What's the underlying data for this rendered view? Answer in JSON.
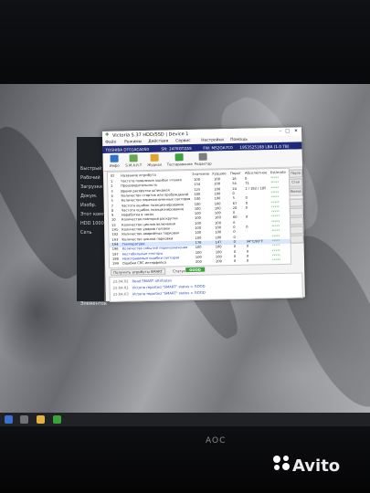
{
  "window": {
    "title": "Victoria 5.37 HDD/SSD | Device 1",
    "menu": [
      "Файл",
      "Режимы",
      "Действия",
      "Сервис",
      "Настройки",
      "Помощь"
    ],
    "info": [
      "TOSHIBA DT01ACA050",
      "SN: 247KGTZAS",
      "FW: MS2OA7C0",
      "1953525168 LBA (1.0 TB)"
    ],
    "toolbar": [
      "Инфо",
      "S.M.A.R.T",
      "Журнал",
      "Тестирование",
      "Редактор"
    ],
    "table_headers": [
      "ID",
      "Название атрибута",
      "Значение",
      "Худшее",
      "Порог",
      "Абсолютное",
      "Estimate"
    ],
    "rows": [
      {
        "id": "1",
        "name": "Частота появления ошибок чтения",
        "val": "100",
        "worst": "100",
        "thr": "16",
        "raw": "0",
        "est": "*****"
      },
      {
        "id": "2",
        "name": "Производительность",
        "val": "134",
        "worst": "100",
        "thr": "54",
        "raw": "71",
        "est": "*****"
      },
      {
        "id": "3",
        "name": "Время раскрутки шпинделя",
        "val": "125",
        "worst": "100",
        "thr": "24",
        "raw": "2 / 182 / 185",
        "est": "*****"
      },
      {
        "id": "4",
        "name": "Количество стартов или пробуждений",
        "val": "100",
        "worst": "100",
        "thr": "0",
        "raw": "",
        "est": "*****"
      },
      {
        "id": "5",
        "name": "Количество переназначенных секторов",
        "val": "100",
        "worst": "100",
        "thr": "5",
        "raw": "0",
        "est": "*****"
      },
      {
        "id": "7",
        "name": "Частота ошибок позиционирования",
        "val": "100",
        "worst": "100",
        "thr": "67",
        "raw": "0",
        "est": "*****"
      },
      {
        "id": "8",
        "name": "Частота ошибок позиционирования",
        "val": "100",
        "worst": "100",
        "thr": "20",
        "raw": "0",
        "est": "*****"
      },
      {
        "id": "9",
        "name": "Наработка в часах",
        "val": "100",
        "worst": "100",
        "thr": "0",
        "raw": "",
        "est": "*****"
      },
      {
        "id": "10",
        "name": "Количество повторов раскрутки",
        "val": "100",
        "worst": "100",
        "thr": "60",
        "raw": "0",
        "est": "*****"
      },
      {
        "id": "12",
        "name": "Количество циклов включения",
        "val": "100",
        "worst": "100",
        "thr": "0",
        "raw": "",
        "est": "*****"
      },
      {
        "id": "191",
        "name": "Количество ударов головок",
        "val": "100",
        "worst": "100",
        "thr": "0",
        "raw": "0",
        "est": "*****"
      },
      {
        "id": "192",
        "name": "Количество аварийных парковок",
        "val": "100",
        "worst": "100",
        "thr": "0",
        "raw": "",
        "est": "*****"
      },
      {
        "id": "193",
        "name": "Количество циклов парковки",
        "val": "100",
        "worst": "100",
        "thr": "0",
        "raw": "",
        "est": "*****"
      },
      {
        "id": "194",
        "name": "Температура",
        "val": "176",
        "worst": "147",
        "thr": "0",
        "raw": "34°C/93°F",
        "est": "*****"
      },
      {
        "id": "196",
        "name": "Количество событий переназначения",
        "val": "100",
        "worst": "100",
        "thr": "0",
        "raw": "0",
        "est": "*****"
      },
      {
        "id": "197",
        "name": "Нестабильные секторы",
        "val": "100",
        "worst": "100",
        "thr": "0",
        "raw": "0",
        "est": "*****"
      },
      {
        "id": "198",
        "name": "Неисправимые ошибки секторов",
        "val": "100",
        "worst": "100",
        "thr": "0",
        "raw": "0",
        "est": "*****"
      },
      {
        "id": "199",
        "name": "Ошибки CRC интерфейса",
        "val": "200",
        "worst": "200",
        "thr": "0",
        "raw": "0",
        "est": "*****"
      }
    ],
    "side_buttons": [
      "Пауза",
      "Стоп",
      "Выход",
      "",
      "",
      "",
      "",
      ""
    ],
    "bottom": {
      "smart_label": "Получить атрибуты SMART",
      "status_label": "Статус",
      "status": "GOOD"
    },
    "log": [
      {
        "time": "23:04:02",
        "msg": "Read SMART attributes"
      },
      {
        "time": "23:04:02",
        "msg": "Victoria reported \"SMART\" status = GOOD"
      },
      {
        "time": "23:04:03",
        "msg": "Victoria reported \"SMART\" status = GOOD"
      }
    ]
  },
  "explorer": {
    "items": [
      "Быстрый",
      "Рабочий",
      "Загрузки",
      "Докум.",
      "Изобр.",
      "Этот комп.",
      "HDD 1000",
      "Сеть"
    ],
    "footer": "Элементов"
  },
  "taskbar": {
    "apps": [
      "start-icon",
      "search-icon",
      "explorer-icon",
      "victoria-icon"
    ]
  },
  "monitor_brand": "AOC",
  "watermark": "Avito",
  "colors": {
    "info_bar": "#1f2a78",
    "good": "#3ca33c",
    "table_selection": "#d9e6ff"
  }
}
